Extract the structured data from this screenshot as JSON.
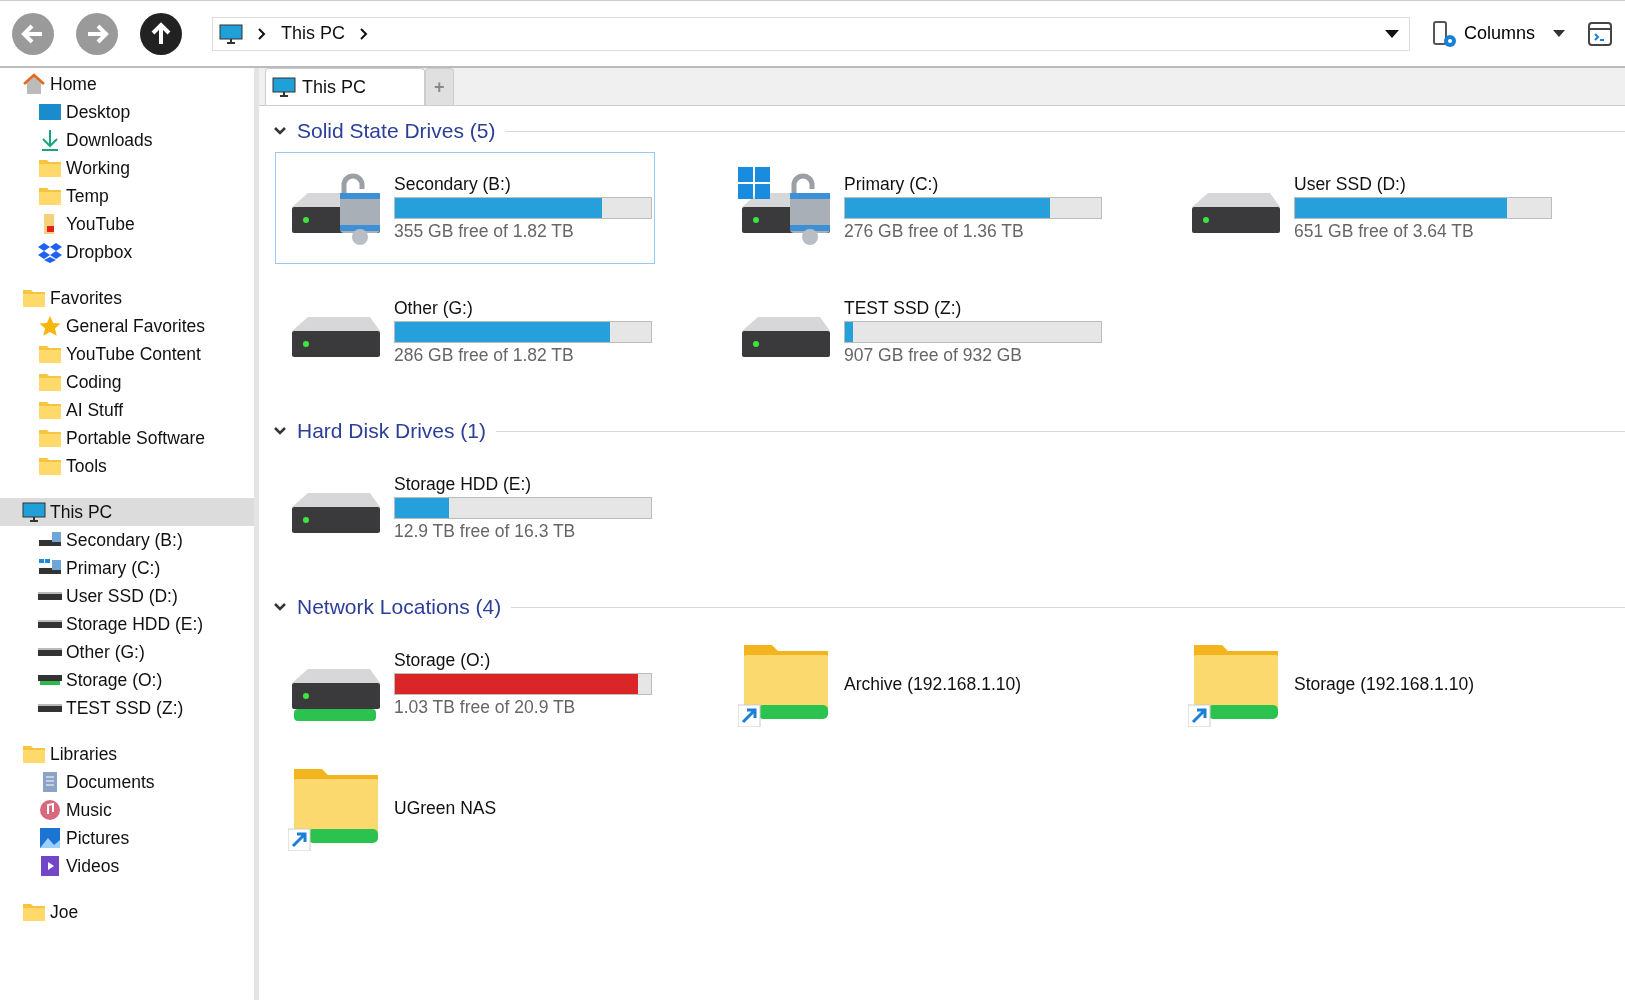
{
  "toolbar": {
    "location": "This PC",
    "view": "Columns"
  },
  "sidebar": [
    {
      "label": "Home",
      "kind": "home",
      "selected": false,
      "children": [
        {
          "label": "Desktop",
          "kind": "desktop"
        },
        {
          "label": "Downloads",
          "kind": "download"
        },
        {
          "label": "Working",
          "kind": "folder"
        },
        {
          "label": "Temp",
          "kind": "folder"
        },
        {
          "label": "YouTube",
          "kind": "yt"
        },
        {
          "label": "Dropbox",
          "kind": "dropbox"
        }
      ]
    },
    {
      "label": "Favorites",
      "kind": "folder",
      "selected": false,
      "children": [
        {
          "label": "General Favorites",
          "kind": "star"
        },
        {
          "label": "YouTube Content",
          "kind": "folder"
        },
        {
          "label": "Coding",
          "kind": "folder"
        },
        {
          "label": "AI Stuff",
          "kind": "folder"
        },
        {
          "label": "Portable Software",
          "kind": "folder"
        },
        {
          "label": "Tools",
          "kind": "folder"
        }
      ]
    },
    {
      "label": "This PC",
      "kind": "pc",
      "selected": true,
      "children": [
        {
          "label": "Secondary (B:)",
          "kind": "drive-lock"
        },
        {
          "label": "Primary (C:)",
          "kind": "drive-win"
        },
        {
          "label": "User SSD (D:)",
          "kind": "drive"
        },
        {
          "label": "Storage HDD (E:)",
          "kind": "drive"
        },
        {
          "label": "Other (G:)",
          "kind": "drive"
        },
        {
          "label": "Storage (O:)",
          "kind": "drive-net"
        },
        {
          "label": "TEST SSD (Z:)",
          "kind": "drive"
        }
      ]
    },
    {
      "label": "Libraries",
      "kind": "folder",
      "selected": false,
      "children": [
        {
          "label": "Documents",
          "kind": "doc"
        },
        {
          "label": "Music",
          "kind": "music"
        },
        {
          "label": "Pictures",
          "kind": "pictures"
        },
        {
          "label": "Videos",
          "kind": "videos"
        }
      ]
    },
    {
      "label": "Joe",
      "kind": "folder",
      "selected": false
    }
  ],
  "tabs": [
    {
      "label": "This PC",
      "selected": true
    },
    {
      "label": "+",
      "selected": false
    }
  ],
  "groups": [
    {
      "title": "Solid State Drives (5)",
      "expanded": true,
      "items": [
        {
          "kind": "locked",
          "name": "Secondary (B:)",
          "level": 0.81,
          "color": "#26a0da",
          "usage": "355 GB free of 1.82 TB",
          "selected": true
        },
        {
          "kind": "system",
          "name": "Primary (C:)",
          "level": 0.8,
          "color": "#26a0da",
          "usage": "276 GB free of 1.36 TB",
          "selected": false
        },
        {
          "kind": "drive",
          "name": "User SSD (D:)",
          "level": 0.83,
          "color": "#26a0da",
          "usage": "651 GB free of 3.64 TB",
          "selected": false
        },
        {
          "kind": "drive",
          "name": "Other (G:)",
          "level": 0.84,
          "color": "#26a0da",
          "usage": "286 GB free of 1.82 TB",
          "selected": false
        },
        {
          "kind": "drive",
          "name": "TEST SSD (Z:)",
          "level": 0.03,
          "color": "#26a0da",
          "usage": "907 GB free of 932 GB",
          "selected": false
        }
      ]
    },
    {
      "title": "Hard Disk Drives (1)",
      "expanded": true,
      "items": [
        {
          "kind": "drive",
          "name": "Storage HDD (E:)",
          "level": 0.21,
          "color": "#26a0da",
          "usage": "12.9 TB free of 16.3 TB",
          "selected": false
        }
      ]
    },
    {
      "title": "Network Locations (4)",
      "expanded": true,
      "items": [
        {
          "kind": "network",
          "name": "Storage (O:)",
          "level": 0.95,
          "color": "#da2626",
          "usage": "1.03 TB free of 20.9 TB",
          "selected": false
        },
        {
          "kind": "share",
          "name": "Archive (192.168.1.10)",
          "selected": false
        },
        {
          "kind": "share",
          "name": "Storage (192.168.1.10)",
          "selected": false
        },
        {
          "kind": "share",
          "name": "UGreen NAS",
          "selected": false
        }
      ]
    }
  ]
}
